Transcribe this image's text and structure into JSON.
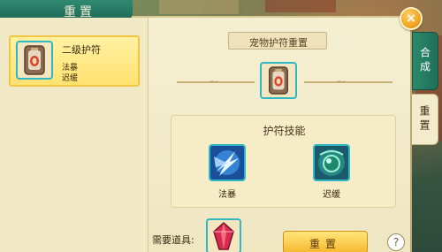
{
  "window": {
    "title": "重置"
  },
  "close_icon": "×",
  "list": {
    "items": [
      {
        "name": "二级护符",
        "skills": [
          "法暴",
          "迟缓"
        ]
      }
    ]
  },
  "reset_panel": {
    "title": "宠物护符重置",
    "skills_heading": "护符技能",
    "skills": [
      {
        "label": "法暴",
        "icon": "lightning-burst-icon"
      },
      {
        "label": "迟缓",
        "icon": "slow-orb-icon"
      }
    ],
    "need_label": "需要道具:",
    "reset_button": "重置",
    "help_label": "?"
  },
  "tabs": [
    {
      "label": "合成"
    },
    {
      "label": "重置"
    }
  ],
  "colors": {
    "title_green": "#1f6a55",
    "accent_cyan": "#2fb7c4",
    "button_gold": "#f5b82e"
  }
}
